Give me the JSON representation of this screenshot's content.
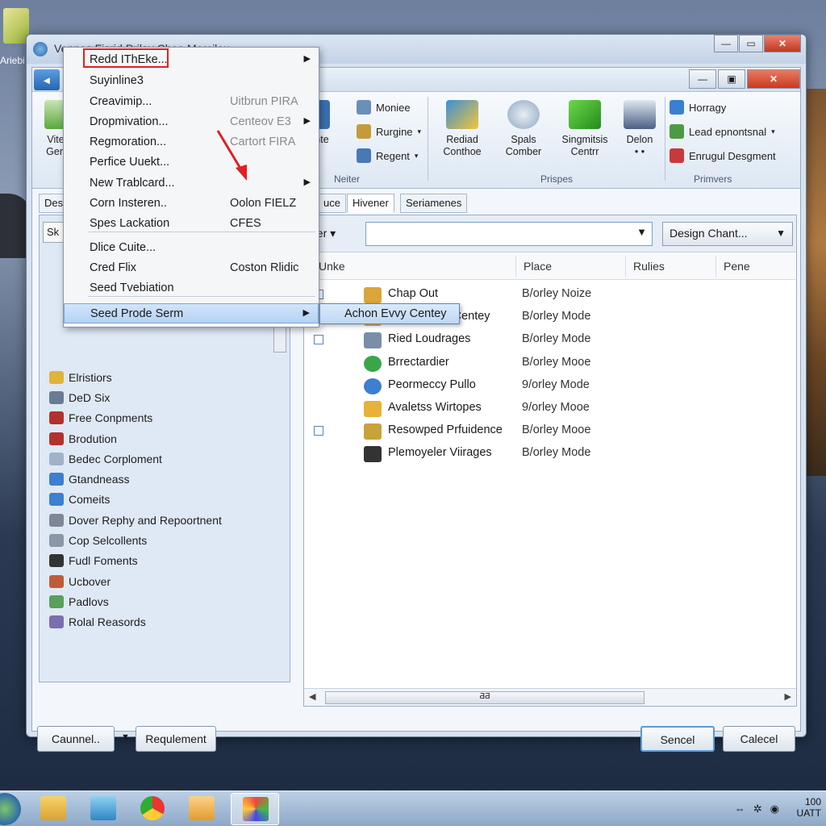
{
  "desktop": {
    "icon_label": "Ariebi"
  },
  "window": {
    "title": "Vennes Fisrid Prilay Cheo Mercilou"
  },
  "ribbon": {
    "left_btn": "Vite\nGen",
    "group1": {
      "label": "Neiter",
      "items": [
        "Moniee",
        "Rurgine",
        "Regent"
      ],
      "big_label": "nte"
    },
    "group2": {
      "label": "Prispes",
      "items": [
        {
          "label": "Rediad\nConthoe"
        },
        {
          "label": "Spals\nComber"
        },
        {
          "label": "Singmitsis\nCentrr"
        },
        {
          "label": "Delon\n• •"
        }
      ]
    },
    "group3": {
      "label": "Primvers",
      "items": [
        "Horragy",
        "Lead epnontsnal",
        "Enrugul Desgment"
      ]
    }
  },
  "tabs": {
    "left": "Des",
    "items": [
      "uce",
      "Hivener",
      "Seriamenes"
    ]
  },
  "left_pane": {
    "combo": "Sk",
    "items": [
      {
        "label": "Elristiors",
        "icon": "star-icon"
      },
      {
        "label": "DeD Six",
        "icon": "document-icon"
      },
      {
        "label": "Free Conpments",
        "icon": "pen-icon"
      },
      {
        "label": "Brodution",
        "icon": "pen-icon"
      },
      {
        "label": "Bedec Corploment",
        "icon": "page-icon"
      },
      {
        "label": "Gtandneass",
        "icon": "globe-icon"
      },
      {
        "label": "Comeits",
        "icon": "globe-icon"
      },
      {
        "label": "Dover Rephy and Repoortnent",
        "icon": "printer-icon"
      },
      {
        "label": "Cop Selcollents",
        "icon": "lock-icon"
      },
      {
        "label": "Fudl Foments",
        "icon": "calculator-icon"
      },
      {
        "label": "Ucbover",
        "icon": "chart-icon"
      },
      {
        "label": "Padlovs",
        "icon": "settings-icon"
      },
      {
        "label": "Rolal Reasords",
        "icon": "table-icon"
      }
    ]
  },
  "filter": {
    "label": "ger",
    "input_value": "",
    "button": "Design Chant..."
  },
  "columns": [
    "Unke",
    "Place",
    "Rulies",
    "Pene"
  ],
  "rows": [
    {
      "name": "Chap Out",
      "place": "B/orley Noize",
      "icon": "image-icon",
      "check": true
    },
    {
      "name": "Achon Evvy Centey",
      "place": "B/orley Mode",
      "icon": "folder-icon",
      "check": false
    },
    {
      "name": "Ried Loudrages",
      "place": "B/orley Mode",
      "icon": "gear-icon",
      "check": true
    },
    {
      "name": "Brrectardier",
      "place": "B/orley Mooe",
      "icon": "refresh-icon",
      "check": false
    },
    {
      "name": "Peormeccy Pullo",
      "place": "9/orley Mode",
      "icon": "globe-icon",
      "check": false
    },
    {
      "name": "Avaletss Wirtopes",
      "place": "9/orley Mooe",
      "icon": "folder-icon",
      "check": false
    },
    {
      "name": "Resowped Prfuidence",
      "place": "B/orley Mooe",
      "icon": "tools-icon",
      "check": true
    },
    {
      "name": "Plemoyeler Viirages",
      "place": "B/orley Mode",
      "icon": "calculator-icon",
      "check": false
    }
  ],
  "hscroll_label": "ƋƋ",
  "bottom": {
    "left1": "Caunnel..",
    "left2": "Requlement",
    "ok": "Sencel",
    "cancel": "Calecel"
  },
  "menu": {
    "items": [
      {
        "label": "Redd IThEke...",
        "short": "",
        "arrow": true
      },
      {
        "label": "Suyinline3",
        "short": "",
        "arrow": false
      },
      {
        "label": "Creavimip...",
        "short": "Uitbrun PIRA",
        "dim": true,
        "arrow": false
      },
      {
        "label": "Dropmivation...",
        "short": "Centeov    E3",
        "dim": true,
        "arrow": true
      },
      {
        "label": "Regmoration...",
        "short": "Cartort FIRA",
        "dim": true,
        "arrow": false
      },
      {
        "label": "Perfice Uuekt...",
        "short": "",
        "arrow": false
      },
      {
        "label": "New Trablcard...",
        "short": "",
        "arrow": true
      },
      {
        "label": "Corn Insteren..",
        "short": "Oolon FIELZ",
        "arrow": false
      },
      {
        "label": "Spes Lackation",
        "short": "CFES",
        "arrow": false
      },
      {
        "label": "Dlice Cuite...",
        "short": "",
        "arrow": false
      },
      {
        "label": "Cred Flix",
        "short": "Coston Rlidic",
        "arrow": false
      },
      {
        "label": "Seed Tvebiation",
        "short": "",
        "arrow": false
      },
      {
        "label": "Seed Prode Serm",
        "short": "",
        "arrow": true
      }
    ],
    "submenu": "Achon Evvy Centey"
  },
  "taskbar": {
    "clock_line1": "100",
    "clock_line2": "UATT"
  },
  "colors": {
    "accent": "#2566b3",
    "close_red": "#c93a1f",
    "annotation_red": "#dd2222"
  }
}
